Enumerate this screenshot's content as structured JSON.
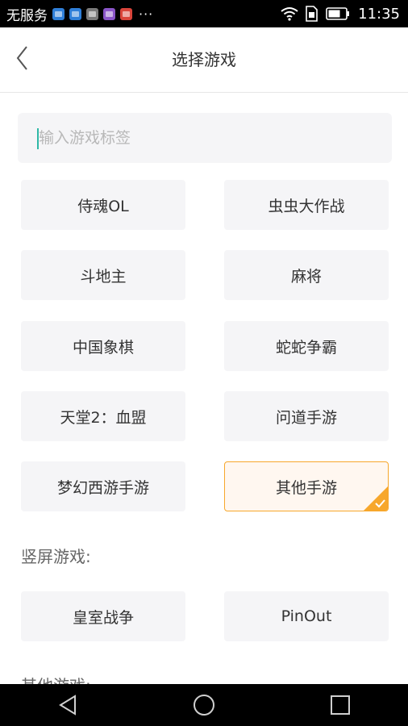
{
  "status_bar": {
    "carrier": "无服务",
    "more": "···",
    "time": "11:35",
    "notification_icons": [
      {
        "name": "notif-blue-app-icon",
        "color": "#2f7fd8"
      },
      {
        "name": "notif-heart-app-icon",
        "color": "#2f7fd8"
      },
      {
        "name": "notif-image-app-icon",
        "color": "#7a7a7a"
      },
      {
        "name": "notif-purple-app-icon",
        "color": "#8a55c8"
      },
      {
        "name": "notif-red-app-icon",
        "color": "#d9443a"
      }
    ]
  },
  "header": {
    "title": "选择游戏"
  },
  "search": {
    "placeholder": "输入游戏标签",
    "value": ""
  },
  "games": [
    {
      "label": "侍魂OL",
      "selected": false
    },
    {
      "label": "虫虫大作战",
      "selected": false
    },
    {
      "label": "斗地主",
      "selected": false
    },
    {
      "label": "麻将",
      "selected": false
    },
    {
      "label": "中国象棋",
      "selected": false
    },
    {
      "label": "蛇蛇争霸",
      "selected": false
    },
    {
      "label": "天堂2：血盟",
      "selected": false
    },
    {
      "label": "问道手游",
      "selected": false
    },
    {
      "label": "梦幻西游手游",
      "selected": false
    },
    {
      "label": "其他手游",
      "selected": true
    }
  ],
  "sections": {
    "vertical_label": "竖屏游戏:",
    "other_label": "其他游戏:"
  },
  "vertical_games": [
    {
      "label": "皇室战争",
      "selected": false
    },
    {
      "label": "PinOut",
      "selected": false
    }
  ],
  "colors": {
    "accent_selected_border": "#f7a72c",
    "accent_selected_bg": "#fff7f0",
    "tile_bg": "#f5f5f7",
    "caret": "#2eb8a6"
  }
}
